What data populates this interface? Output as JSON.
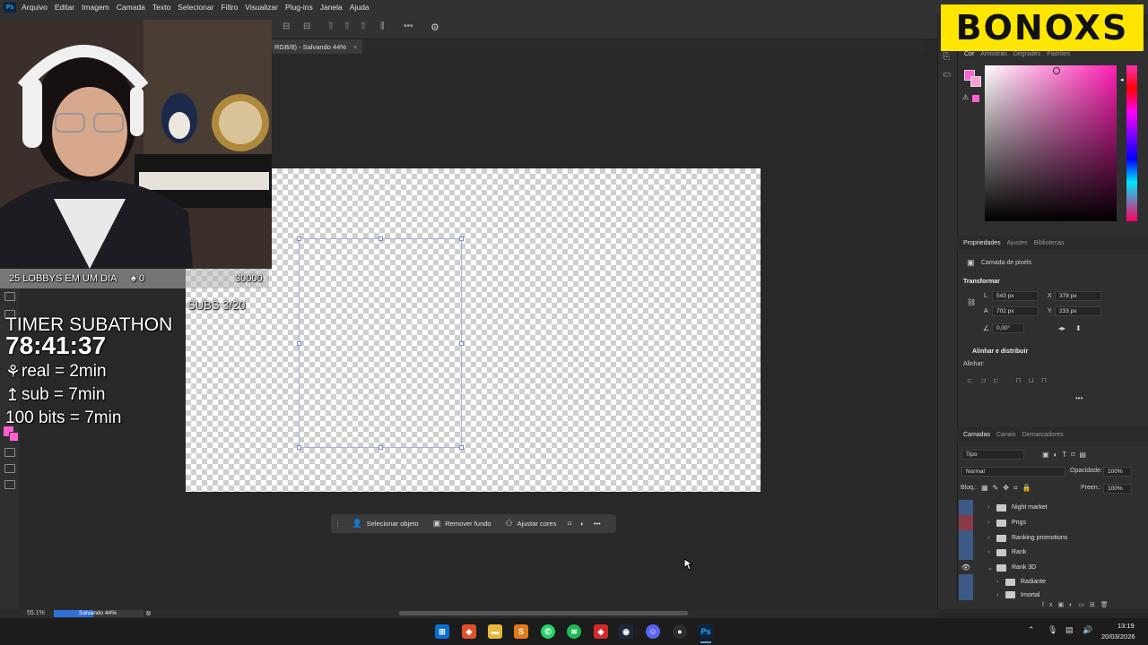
{
  "menubar": {
    "app_icon": "Ps",
    "items": [
      "Arquivo",
      "Editar",
      "Imagem",
      "Camada",
      "Texto",
      "Selecionar",
      "Filtro",
      "Visualizar",
      "Plug-ins",
      "Janela",
      "Ajuda"
    ]
  },
  "document_tab": {
    "title": "RGB/8) - Salvando 44%",
    "close": "×"
  },
  "context_bar": {
    "select_object": "Selecionar objeto",
    "remove_bg": "Remover fundo",
    "adjust_colors": "Ajustar cores",
    "more": "•••"
  },
  "color_panel": {
    "tabs": [
      "Cor",
      "Amostras",
      "Degradês",
      "Padrões"
    ],
    "foreground": "#ff5fd0",
    "background": "#ff9fd6",
    "picker_hue": "#ff1fb3"
  },
  "properties_panel": {
    "tabs": [
      "Propriedades",
      "Ajustes",
      "Bibliotecas"
    ],
    "layer_type": "Camada de pixels",
    "transform_title": "Transformar",
    "L_label": "L",
    "L_value": "543 px",
    "A_label": "A",
    "A_value": "702 px",
    "X_label": "X",
    "X_value": "378 px",
    "Y_label": "Y",
    "Y_value": "233 px",
    "angle_value": "0,00°",
    "align_title": "Alinhar e distribuir",
    "align_label": "Alinhar:",
    "more": "•••"
  },
  "layers_panel": {
    "tabs": [
      "Camadas",
      "Canais",
      "Demarcadores"
    ],
    "filter": "Tipo",
    "blend_mode": "Normal",
    "opacity_label": "Opacidade:",
    "opacity_value": "100%",
    "lock_label": "Bloq.:",
    "fill_label": "Preen.:",
    "fill_value": "100%",
    "layers": [
      {
        "name": "Night market",
        "visible": false,
        "color": "#3d5a86"
      },
      {
        "name": "Pngs",
        "visible": false,
        "color": "#8a3a46"
      },
      {
        "name": "Ranking promotions",
        "visible": false,
        "color": "#3d5a86"
      },
      {
        "name": "Rank",
        "visible": false,
        "color": "#3d5a86"
      },
      {
        "name": "Rank 3D",
        "visible": true,
        "color": "#3d5a86"
      },
      {
        "name": "Radiante",
        "visible": false,
        "color": "#3d5a86"
      },
      {
        "name": "Imortal",
        "visible": false,
        "color": "#3d5a86"
      }
    ]
  },
  "status": {
    "zoom": "55.1%",
    "saving": "Salvando 44%",
    "progress": 0.44
  },
  "stream_overlay": {
    "lobbys": "25 LOBBYS EM UM DIA",
    "lobby_count": "0",
    "goal": "30000",
    "subs": "SUBS 3/20",
    "timer_title": "TIMER SUBATHON",
    "timer": "78:41:37",
    "rule1": "real = 2min",
    "rule2": "sub =  7min",
    "rule3": "100 bits = 7min"
  },
  "brand_logo": "BONOXS",
  "taskbar": {
    "time": "13:19",
    "date": "20/03/2026"
  }
}
